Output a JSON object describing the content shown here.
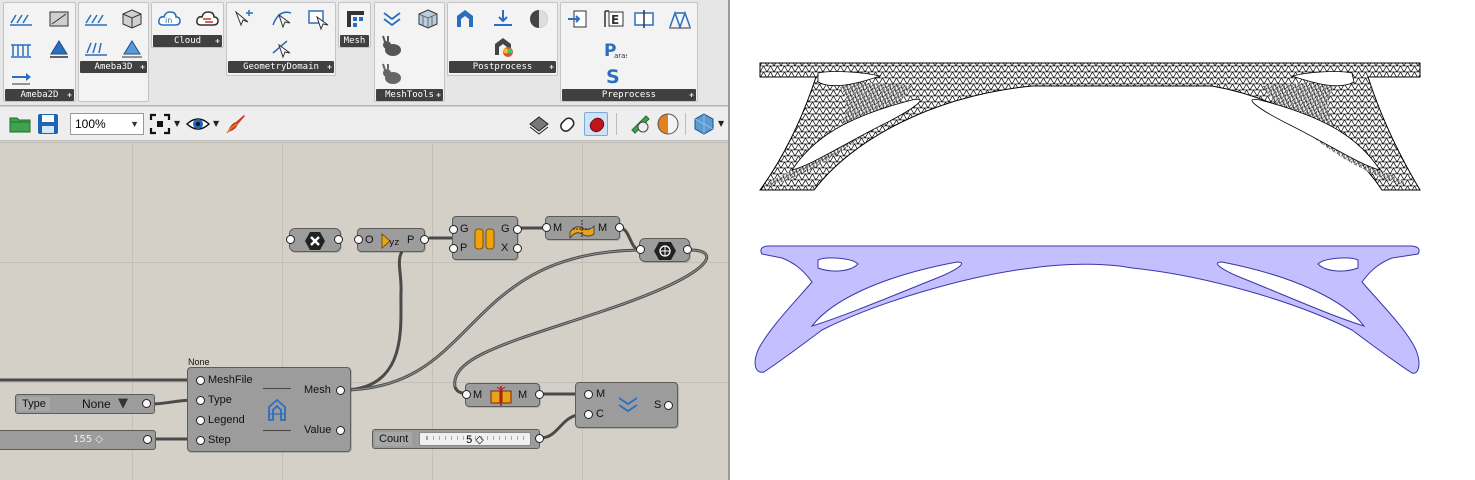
{
  "ribbon": {
    "groups": {
      "ameba2d": "Ameba2D",
      "ameba3d": "Ameba3D",
      "cloud": "Cloud",
      "geometry": "GeometryDomain",
      "mesh": "Mesh",
      "meshtools": "MeshTools",
      "postprocess": "Postprocess",
      "preprocess": "Preprocess"
    },
    "icon_letters": {
      "paras_p": "P",
      "paras_text": "aras",
      "s": "S",
      "e": "E",
      "cloud_in": "in"
    }
  },
  "toolbar": {
    "zoom": "100%"
  },
  "canvas": {
    "none_tag": "None",
    "main_node": {
      "inputs": [
        "MeshFile",
        "Type",
        "Legend",
        "Step"
      ],
      "outputs": [
        "Mesh",
        "Value"
      ]
    },
    "type_list": {
      "label": "Type",
      "value": "None"
    },
    "step_slider": {
      "value": "155"
    },
    "count_slider": {
      "label": "Count",
      "value": "5"
    },
    "deconstruct_node": {
      "in": "O",
      "out": "P"
    },
    "group_node": {
      "in": [
        "G",
        "P"
      ],
      "out": [
        "G",
        "X"
      ]
    },
    "mesh_a": {
      "in": "M",
      "out": "M"
    },
    "mesh_b": {
      "in": "M",
      "out": "M"
    },
    "subdiv_node": {
      "in": [
        "M",
        "C"
      ],
      "out": "S"
    }
  },
  "colors": {
    "canvas": "#d4d0c8",
    "node": "#9c9c9c",
    "smooth_fill": "#c4bfff",
    "smooth_stroke": "#3a36a8",
    "mesh_stroke": "#000000"
  }
}
